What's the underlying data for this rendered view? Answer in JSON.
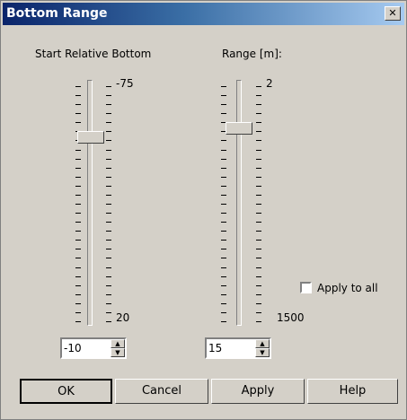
{
  "window": {
    "title": "Bottom Range",
    "close_glyph": "✕"
  },
  "start_slider": {
    "label": "Start Relative Bottom",
    "min_label": "-75",
    "max_label": "20",
    "value": "-10"
  },
  "range_slider": {
    "label": "Range [m]:",
    "min_label": "2",
    "max_label": "1500",
    "value": "15"
  },
  "apply_all": {
    "label": "Apply to all",
    "checked": false
  },
  "buttons": {
    "ok": "OK",
    "cancel": "Cancel",
    "apply": "Apply",
    "help": "Help"
  },
  "icons": {
    "spin_up": "up-arrow-icon",
    "spin_down": "down-arrow-icon"
  }
}
